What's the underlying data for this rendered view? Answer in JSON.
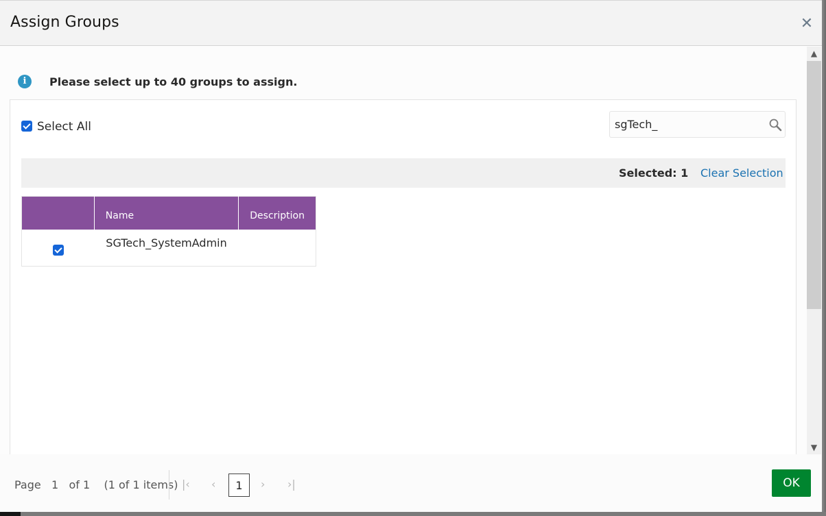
{
  "dialog": {
    "title": "Assign Groups",
    "close_icon": "close-icon"
  },
  "info": {
    "icon": "info-icon",
    "message": "Please select up to 40 groups to assign."
  },
  "select_all": {
    "label": "Select All",
    "checked": true
  },
  "search": {
    "value": "sgTech_",
    "icon": "search-icon"
  },
  "toolbar": {
    "selected_text": "Selected: 1",
    "clear_selection": "Clear Selection"
  },
  "table": {
    "columns": [
      "",
      "Name",
      "Description"
    ],
    "rows": [
      {
        "checked": true,
        "name": "SGTech_SystemAdmin",
        "description": ""
      }
    ]
  },
  "pagination": {
    "page_label": "Page",
    "current_page": "1",
    "of_label": "of 1",
    "items_label": "(1 of 1 items)",
    "page_box": "1",
    "first_icon": "first-page-icon",
    "prev_icon": "previous-page-icon",
    "next_icon": "next-page-icon",
    "last_icon": "last-page-icon"
  },
  "footer": {
    "ok_label": "OK"
  },
  "colors": {
    "table_header": "#864f9b",
    "ok_button": "#00852f",
    "link": "#1b72b1",
    "checkbox": "#1565d8",
    "info_icon": "#2f96c4"
  }
}
